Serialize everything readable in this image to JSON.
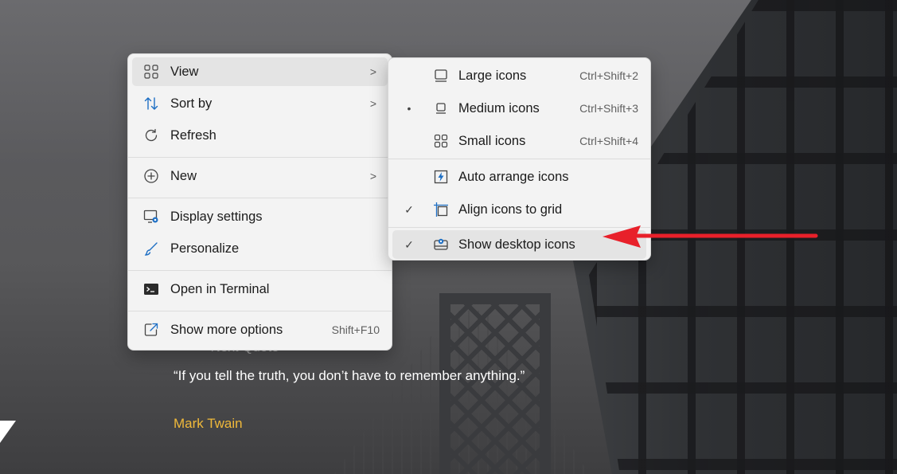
{
  "wallpaper": {
    "quote_header": "> Next Quote",
    "quote_text": "“If you tell the truth, you don’t have to remember anything.”",
    "quote_author": "Mark Twain"
  },
  "context_menu": {
    "items": [
      {
        "label": "View",
        "icon": "grid-icon",
        "has_submenu": true
      },
      {
        "label": "Sort by",
        "icon": "sort-icon",
        "has_submenu": true
      },
      {
        "label": "Refresh",
        "icon": "refresh-icon"
      },
      {
        "label": "New",
        "icon": "plus-circle-icon",
        "has_submenu": true
      },
      {
        "label": "Display settings",
        "icon": "display-settings-icon"
      },
      {
        "label": "Personalize",
        "icon": "brush-icon"
      },
      {
        "label": "Open in Terminal",
        "icon": "terminal-icon"
      },
      {
        "label": "Show more options",
        "icon": "share-icon",
        "shortcut": "Shift+F10"
      }
    ],
    "chevron": ">"
  },
  "view_submenu": {
    "items": [
      {
        "label": "Large icons",
        "icon": "monitor-icon",
        "shortcut": "Ctrl+Shift+2",
        "mark": ""
      },
      {
        "label": "Medium icons",
        "icon": "monitor-small-icon",
        "shortcut": "Ctrl+Shift+3",
        "mark": "•"
      },
      {
        "label": "Small icons",
        "icon": "small-grid-icon",
        "shortcut": "Ctrl+Shift+4",
        "mark": ""
      },
      {
        "label": "Auto arrange icons",
        "icon": "auto-arrange-icon",
        "mark": ""
      },
      {
        "label": "Align icons to grid",
        "icon": "align-grid-icon",
        "mark": "✓"
      },
      {
        "label": "Show desktop icons",
        "icon": "desktop-icon",
        "mark": "✓"
      }
    ]
  },
  "colors": {
    "menu_bg": "#f3f3f3",
    "hover_bg": "#e4e4e4",
    "accent_blue": "#0067c0",
    "annotation_red": "#e8202a",
    "quote_author": "#f0b93a"
  }
}
